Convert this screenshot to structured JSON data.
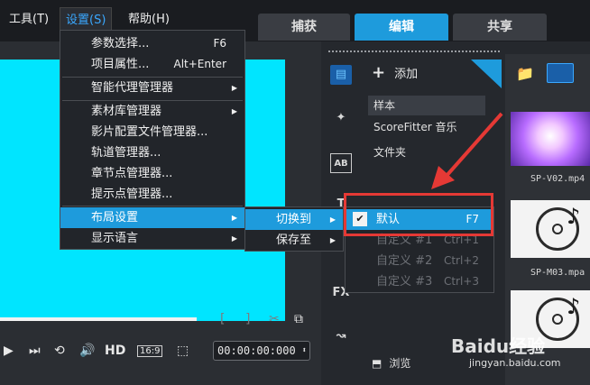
{
  "menubar": {
    "items": [
      {
        "label": "工具(T)"
      },
      {
        "label": "设置(S)"
      },
      {
        "label": "帮助(H)"
      }
    ]
  },
  "mode_tabs": [
    "捕获",
    "编辑",
    "共享"
  ],
  "settings_menu": {
    "items": [
      {
        "label": "参数选择...",
        "shortcut": "F6"
      },
      {
        "label": "项目属性...",
        "shortcut": "Alt+Enter"
      },
      {
        "label": "智能代理管理器"
      },
      {
        "label": "素材库管理器"
      },
      {
        "label": "影片配置文件管理器..."
      },
      {
        "label": "轨道管理器..."
      },
      {
        "label": "章节点管理器..."
      },
      {
        "label": "提示点管理器..."
      },
      {
        "label": "布局设置"
      },
      {
        "label": "显示语言"
      }
    ]
  },
  "layout_submenu": {
    "items": [
      {
        "label": "切换到"
      },
      {
        "label": "保存至"
      }
    ]
  },
  "switch_submenu": {
    "items": [
      {
        "label": "默认",
        "shortcut": "F7",
        "checked": "✔"
      },
      {
        "label": "自定义 #1",
        "shortcut": "Ctrl+1"
      },
      {
        "label": "自定义 #2",
        "shortcut": "Ctrl+2"
      },
      {
        "label": "自定义 #3",
        "shortcut": "Ctrl+3"
      }
    ]
  },
  "library": {
    "add_label": "添加",
    "side_icons": {
      "ab": "AB",
      "t": "T",
      "fx": "FX"
    },
    "items": [
      "样本",
      "ScoreFitter 音乐",
      "文件夹"
    ],
    "browse_label": "浏览",
    "thumbs": [
      {
        "label": "SP-V02.mp4"
      },
      {
        "label": "SP-M03.mpa"
      }
    ]
  },
  "player": {
    "hd_label": "HD",
    "aspect_label": "16:9",
    "timecode": "00:00:00:000",
    "mark_in": "[",
    "mark_out": "]"
  },
  "watermark": {
    "brand": "Baidu经验",
    "url": "jingyan.baidu.com"
  },
  "colors": {
    "accent": "#1e9bdc",
    "preview": "#00e5ff",
    "highlight_box": "#e53935"
  }
}
